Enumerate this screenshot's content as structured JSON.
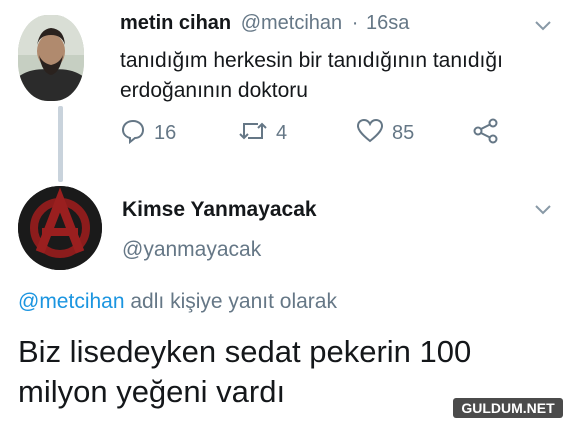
{
  "tweet1": {
    "display_name": "metin cihan",
    "handle": "@metcihan",
    "separator": "·",
    "time": "16sa",
    "text": "tanıdığım herkesin bir tanıdığının tanıdığı erdoğanının doktoru",
    "counts": {
      "replies": "16",
      "retweets": "4",
      "likes": "85"
    },
    "icons": [
      "reply-icon",
      "retweet-icon",
      "like-icon",
      "share-icon",
      "chevron-down-icon"
    ]
  },
  "tweet2": {
    "display_name": "Kimse Yanmayacak",
    "handle": "@yanmayacak",
    "reply_mention": "@metcihan",
    "reply_context": "adlı kişiye yanıt olarak",
    "text": "Biz lisedeyken sedat pekerin 100 milyon yeğeni vardı",
    "icons": [
      "chevron-down-icon"
    ]
  },
  "watermark": {
    "text": "GULDUM.NET"
  },
  "colors": {
    "text": "#14171a",
    "secondary": "#657786",
    "link": "#1b95e0",
    "thread_line": "#c9d3dc"
  }
}
